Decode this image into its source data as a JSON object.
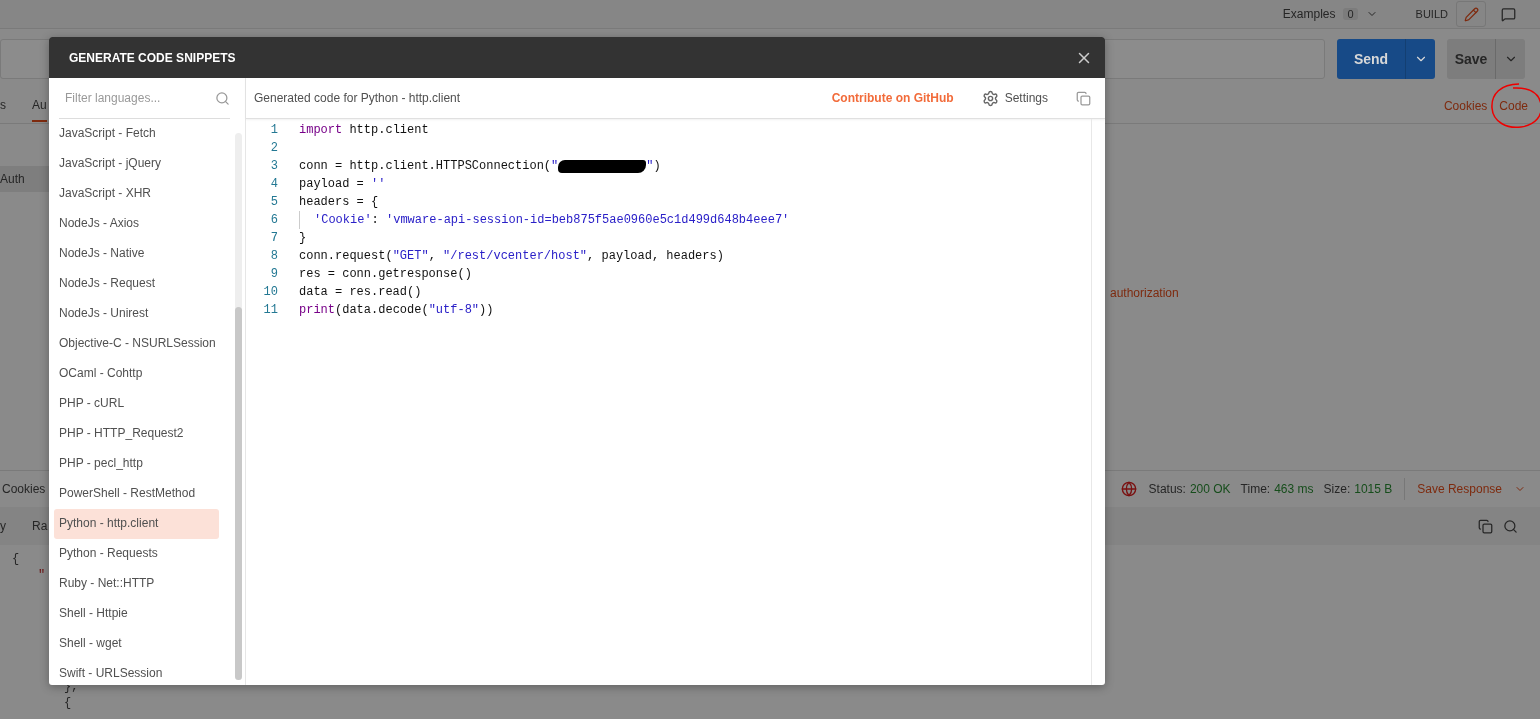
{
  "app": {
    "header": {
      "examples_label": "Examples",
      "examples_count": "0",
      "build_label": "BUILD"
    },
    "request": {
      "send": "Send",
      "save": "Save",
      "tabs": [
        {
          "label": "s",
          "selected": false
        },
        {
          "label": "Au",
          "selected": true
        }
      ],
      "links": [
        "Cookies",
        "Code"
      ],
      "auth_tab": "Auth",
      "hint": "authorization"
    },
    "response": {
      "tab": "Cookies",
      "status_label": "Status:",
      "status": "200 OK",
      "time_label": "Time:",
      "time": "463 ms",
      "size_label": "Size:",
      "size": "1015 B",
      "save_response": "Save Response",
      "view_tabs": [
        "y",
        "Ra"
      ],
      "body": [
        {
          "text": "{",
          "children": [
            {
              "text": "\"",
              "children": [
                {
                  "text": "},"
                },
                {
                  "text": "{"
                }
              ]
            }
          ]
        }
      ]
    }
  },
  "modal": {
    "title": "GENERATE CODE SNIPPETS",
    "filter": {
      "placeholder": "Filter languages..."
    },
    "languages": [
      {
        "label": "JavaScript - Fetch",
        "selected": false
      },
      {
        "label": "JavaScript - jQuery",
        "selected": false
      },
      {
        "label": "JavaScript - XHR",
        "selected": false
      },
      {
        "label": "NodeJs - Axios",
        "selected": false
      },
      {
        "label": "NodeJs - Native",
        "selected": false
      },
      {
        "label": "NodeJs - Request",
        "selected": false
      },
      {
        "label": "NodeJs - Unirest",
        "selected": false
      },
      {
        "label": "Objective-C - NSURLSession",
        "selected": false
      },
      {
        "label": "OCaml - Cohttp",
        "selected": false
      },
      {
        "label": "PHP - cURL",
        "selected": false
      },
      {
        "label": "PHP - HTTP_Request2",
        "selected": false
      },
      {
        "label": "PHP - pecl_http",
        "selected": false
      },
      {
        "label": "PowerShell - RestMethod",
        "selected": false
      },
      {
        "label": "Python - http.client",
        "selected": true
      },
      {
        "label": "Python - Requests",
        "selected": false
      },
      {
        "label": "Ruby - Net::HTTP",
        "selected": false
      },
      {
        "label": "Shell - Httpie",
        "selected": false
      },
      {
        "label": "Shell - wget",
        "selected": false
      },
      {
        "label": "Swift - URLSession",
        "selected": false
      }
    ],
    "code_header": "Generated code for Python - http.client",
    "contribute": "Contribute on GitHub",
    "settings": "Settings",
    "code": [
      {
        "number": "1",
        "tokens": [
          {
            "kind": "keyword",
            "text": "import"
          },
          {
            "kind": "plain",
            "text": " http.client"
          }
        ]
      },
      {
        "number": "2"
      },
      {
        "number": "3",
        "tokens": [
          {
            "kind": "plain",
            "text": "conn = http.client.HTTPSConnection("
          },
          {
            "kind": "string",
            "text": "\""
          },
          {
            "kind": "redacted"
          },
          {
            "kind": "string",
            "text": "\""
          },
          {
            "kind": "plain",
            "text": ")"
          }
        ]
      },
      {
        "number": "4",
        "tokens": [
          {
            "kind": "plain",
            "text": "payload = "
          },
          {
            "kind": "string",
            "text": "''"
          }
        ]
      },
      {
        "number": "5",
        "tokens": [
          {
            "kind": "plain",
            "text": "headers = {"
          }
        ]
      },
      {
        "number": "6",
        "guide": true,
        "tokens": [
          {
            "kind": "string",
            "text": "'Cookie'"
          },
          {
            "kind": "plain",
            "text": ": "
          },
          {
            "kind": "string",
            "text": "'vmware-api-session-id=beb875f5ae0960e5c1d499d648b4eee7'"
          }
        ]
      },
      {
        "number": "7",
        "tokens": [
          {
            "kind": "plain",
            "text": "}"
          }
        ]
      },
      {
        "number": "8",
        "tokens": [
          {
            "kind": "plain",
            "text": "conn.request("
          },
          {
            "kind": "string",
            "text": "\"GET\""
          },
          {
            "kind": "plain",
            "text": ", "
          },
          {
            "kind": "string",
            "text": "\"/rest/vcenter/host\""
          },
          {
            "kind": "plain",
            "text": ", payload, headers)"
          }
        ]
      },
      {
        "number": "9",
        "tokens": [
          {
            "kind": "plain",
            "text": "res = conn.getresponse()"
          }
        ]
      },
      {
        "number": "10",
        "tokens": [
          {
            "kind": "plain",
            "text": "data = res.read()"
          }
        ]
      },
      {
        "number": "11",
        "tokens": [
          {
            "kind": "keyword",
            "text": "print"
          },
          {
            "kind": "plain",
            "text": "(data.decode("
          },
          {
            "kind": "string",
            "text": "\"utf-8\""
          },
          {
            "kind": "plain",
            "text": "))"
          }
        ]
      }
    ]
  }
}
